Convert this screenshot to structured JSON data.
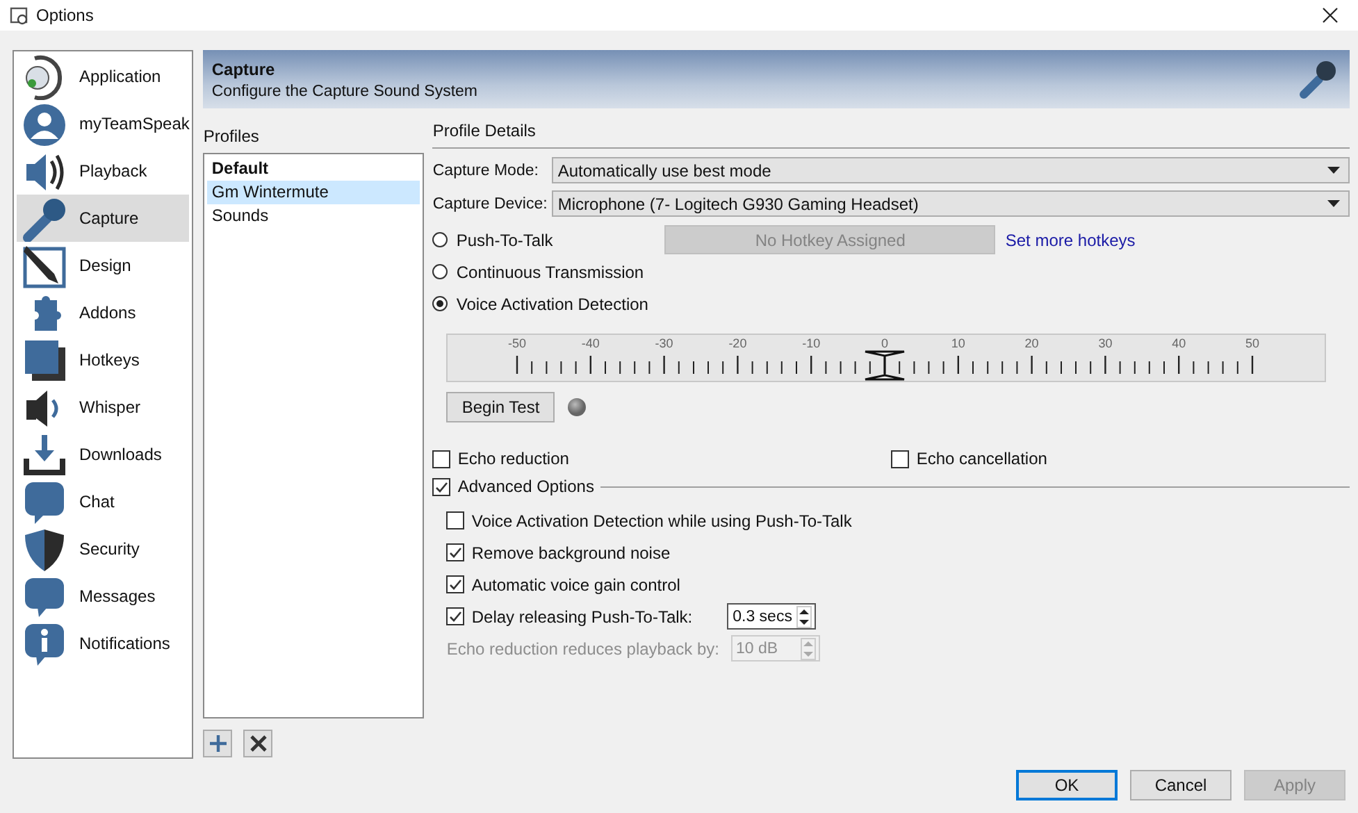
{
  "window": {
    "title": "Options"
  },
  "sidebar": {
    "items": [
      {
        "label": "Application",
        "selected": false
      },
      {
        "label": "myTeamSpeak",
        "selected": false
      },
      {
        "label": "Playback",
        "selected": false
      },
      {
        "label": "Capture",
        "selected": true
      },
      {
        "label": "Design",
        "selected": false
      },
      {
        "label": "Addons",
        "selected": false
      },
      {
        "label": "Hotkeys",
        "selected": false
      },
      {
        "label": "Whisper",
        "selected": false
      },
      {
        "label": "Downloads",
        "selected": false
      },
      {
        "label": "Chat",
        "selected": false
      },
      {
        "label": "Security",
        "selected": false
      },
      {
        "label": "Messages",
        "selected": false
      },
      {
        "label": "Notifications",
        "selected": false
      }
    ]
  },
  "header": {
    "title": "Capture",
    "subtitle": "Configure the Capture Sound System"
  },
  "profiles": {
    "label": "Profiles",
    "items": [
      {
        "label": "Default",
        "is_default": true,
        "selected": false
      },
      {
        "label": "Gm Wintermute",
        "is_default": false,
        "selected": true
      },
      {
        "label": "Sounds",
        "is_default": false,
        "selected": false
      }
    ]
  },
  "details": {
    "heading": "Profile Details",
    "fields": [
      {
        "label": "Capture Mode:",
        "value": "Automatically use best mode"
      },
      {
        "label": "Capture Device:",
        "value": "Microphone (7- Logitech G930 Gaming Headset)"
      }
    ],
    "modes": [
      {
        "label": "Push-To-Talk",
        "selected": false
      },
      {
        "label": "Continuous Transmission",
        "selected": false
      },
      {
        "label": "Voice Activation Detection",
        "selected": true
      }
    ],
    "hotkey_button": {
      "label": "No Hotkey Assigned",
      "disabled": true
    },
    "hotkey_link": "Set more hotkeys",
    "vad": {
      "scale_labels": [
        "-50",
        "-40",
        "-30",
        "-20",
        "-10",
        "0",
        "10",
        "20",
        "30",
        "40",
        "50"
      ],
      "level": 0.5
    },
    "test_button": "Begin Test",
    "echo": [
      {
        "label": "Echo reduction",
        "checked": false
      },
      {
        "label": "Echo cancellation",
        "checked": false
      }
    ],
    "advanced": {
      "label": "Advanced Options",
      "checked": true,
      "options": [
        {
          "kind": "checkbox",
          "label": "Voice Activation Detection while using Push-To-Talk",
          "checked": false
        },
        {
          "kind": "checkbox",
          "label": "Remove background noise",
          "checked": true
        },
        {
          "kind": "checkbox",
          "label": "Automatic voice gain control",
          "checked": true
        },
        {
          "kind": "checkbox_spin",
          "label": "Delay releasing Push-To-Talk:",
          "checked": true,
          "value": "0.3 secs",
          "disabled": false
        },
        {
          "kind": "spin",
          "label": "Echo reduction reduces playback by:",
          "value": "10 dB",
          "disabled": true
        }
      ]
    }
  },
  "buttons": [
    {
      "label": "OK",
      "default": true,
      "disabled": false
    },
    {
      "label": "Cancel",
      "default": false,
      "disabled": false
    },
    {
      "label": "Apply",
      "default": false,
      "disabled": true
    }
  ]
}
